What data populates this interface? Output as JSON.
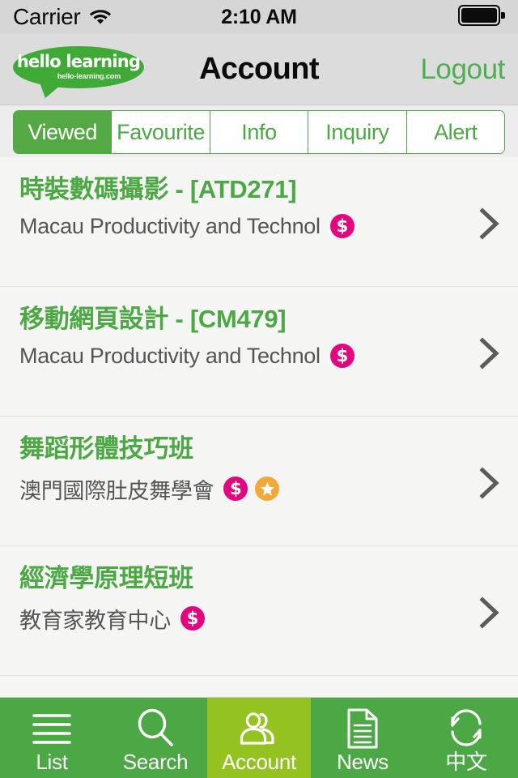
{
  "statusbar": {
    "carrier": "Carrier",
    "wifi_icon": "wifi-icon",
    "time": "2:10 AM",
    "battery_icon": "battery-full-icon"
  },
  "navbar": {
    "logo_main": "hello learning",
    "logo_sub": "hello-learning.com",
    "title": "Account",
    "action_label": "Logout"
  },
  "segmented": {
    "items": [
      {
        "label": "Viewed",
        "active": true
      },
      {
        "label": "Favourite",
        "active": false
      },
      {
        "label": "Info",
        "active": false
      },
      {
        "label": "Inquiry",
        "active": false
      },
      {
        "label": "Alert",
        "active": false
      }
    ]
  },
  "list": {
    "rows": [
      {
        "title": "時裝數碼攝影 - [ATD271]",
        "subtitle": "Macau Productivity and Technol",
        "badges": [
          "money-badge"
        ],
        "chevron": "chevron-right-icon"
      },
      {
        "title": "移動網頁設計 - [CM479]",
        "subtitle": "Macau Productivity and Technol",
        "badges": [
          "money-badge"
        ],
        "chevron": "chevron-right-icon"
      },
      {
        "title": "舞蹈形體技巧班",
        "subtitle": "澳門國際肚皮舞學會",
        "badges": [
          "money-badge",
          "star-badge"
        ],
        "chevron": "chevron-right-icon"
      },
      {
        "title": "經濟學原理短班",
        "subtitle": "教育家教育中心",
        "badges": [
          "money-badge"
        ],
        "chevron": "chevron-right-icon"
      }
    ]
  },
  "tabbar": {
    "tabs": [
      {
        "label": "List",
        "icon": "list-icon",
        "active": false
      },
      {
        "label": "Search",
        "icon": "search-icon",
        "active": false
      },
      {
        "label": "Account",
        "icon": "account-icon",
        "active": true
      },
      {
        "label": "News",
        "icon": "news-icon",
        "active": false
      },
      {
        "label": "中文",
        "icon": "language-swap-icon",
        "active": false
      }
    ]
  },
  "colors": {
    "brand_green": "#4ca844",
    "active_tab_green": "#93c221",
    "money_badge_pink": "#e2077f",
    "star_badge_orange": "#f2a93b",
    "title_green": "#4ca844",
    "list_bg": "#f5f5f4",
    "navbar_bg": "#dcdcdc",
    "statusbar_bg": "#d6d6d6"
  }
}
